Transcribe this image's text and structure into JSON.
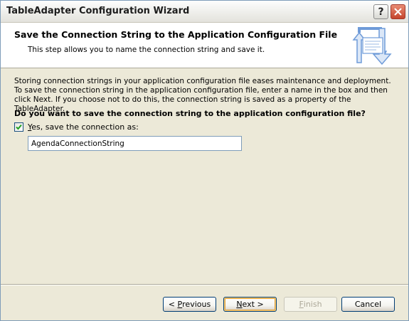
{
  "window": {
    "title": "TableAdapter Configuration Wizard",
    "help_label": "?"
  },
  "header": {
    "title": "Save the Connection String to the Application Configuration File",
    "subtitle": "This step allows you to name the connection string and save it."
  },
  "body": {
    "description": "Storing connection strings in your application configuration file eases maintenance and deployment. To save the connection string in the application configuration file, enter a name in the box and then click Next. If you choose not to do this, the connection string is saved as a property of the TableAdapter.",
    "question": "Do you want to save the connection string to the application configuration file?",
    "checkbox": {
      "checked": true,
      "label_accel": "Y",
      "label_rest": "es, save the connection as:"
    },
    "connection_name": "AgendaConnectionString"
  },
  "buttons": {
    "previous": {
      "pre": "< ",
      "accel": "P",
      "post": "revious"
    },
    "next": {
      "accel": "N",
      "post": "ext >"
    },
    "finish": {
      "accel": "F",
      "post": "inish"
    },
    "cancel": {
      "label": "Cancel"
    }
  },
  "icons": {
    "help": "help-icon",
    "close": "close-icon",
    "header_graphic": "config-file-arrows-icon",
    "checkmark": "checkmark-icon"
  },
  "colors": {
    "dialog_bg": "#ece9d8",
    "header_bg": "#ffffff",
    "close_button": "#c4442c",
    "default_button_highlight": "#e5a33a",
    "graphic_blue": "#6f9bd8"
  }
}
